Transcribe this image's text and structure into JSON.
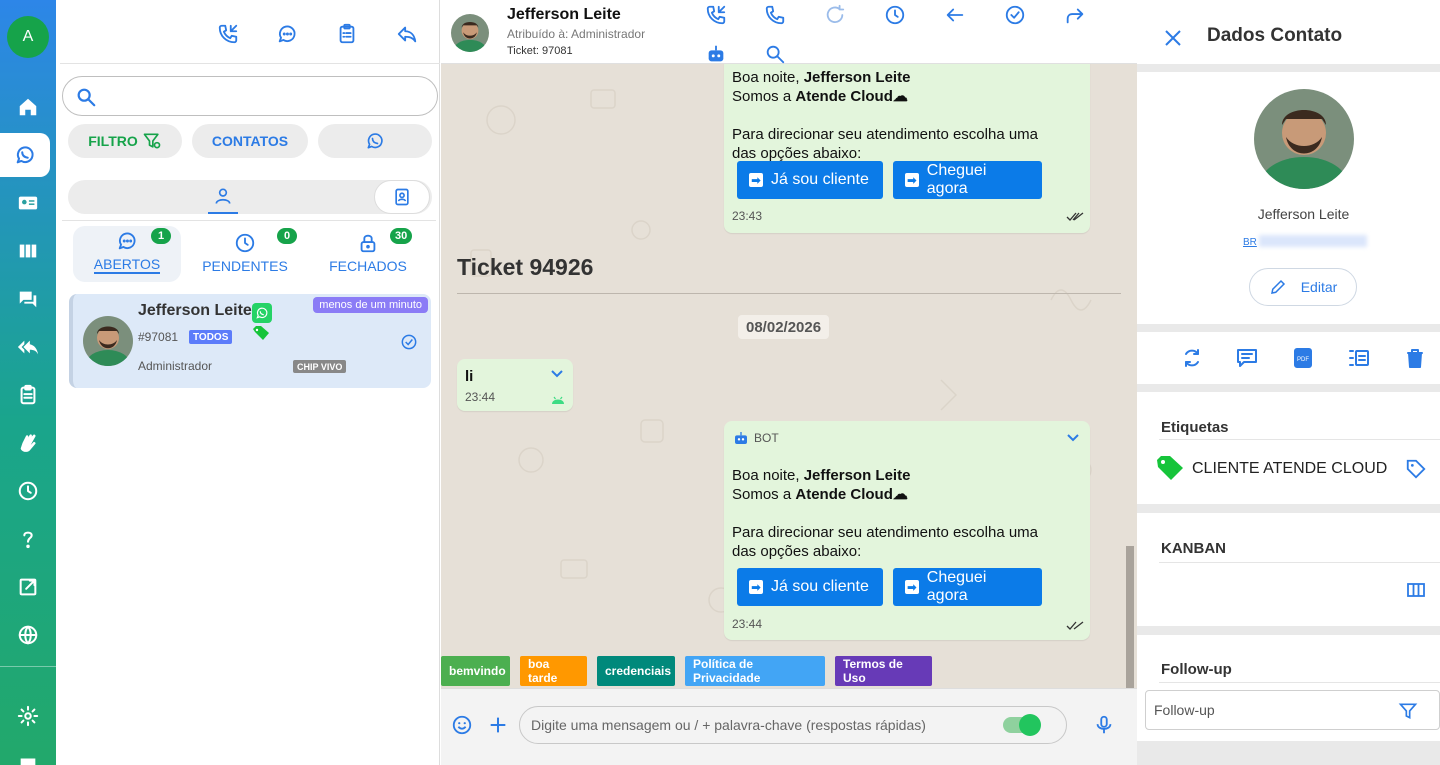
{
  "user_avatar_letter": "A",
  "list": {
    "filter_label": "FILTRO",
    "contacts_label": "CONTATOS",
    "tabs": [
      {
        "label": "ABERTOS",
        "count": "1"
      },
      {
        "label": "PENDENTES",
        "count": "0"
      },
      {
        "label": "FECHADOS",
        "count": "30"
      }
    ],
    "ticket": {
      "name": "Jefferson Leite",
      "time": "menos de um minuto",
      "number": "#97081",
      "queue": "TODOS",
      "agent": "Administrador",
      "connection": "CHIP VIVO"
    }
  },
  "chat": {
    "contact_name": "Jefferson Leite",
    "assigned": "Atribuído à: Administrador",
    "ticket_label": "Ticket: 97081",
    "msg1": {
      "greeting_prefix": "Boa noite, ",
      "greeting_name": "Jefferson Leite",
      "company_prefix": "Somos a ",
      "company_name": "Atende Cloud",
      "cloud": "☁",
      "prompt_line1": "Para direcionar seu atendimento escolha uma",
      "prompt_line2": "das opções abaixo:",
      "btn1": "Já sou cliente",
      "btn2": "Cheguei agora",
      "time": "23:43"
    },
    "ticket_title": "Ticket 94926",
    "date": "08/02/2026",
    "msg_in": {
      "text": "li",
      "time": "23:44"
    },
    "msg2": {
      "sender": "BOT",
      "greeting_prefix": "Boa noite, ",
      "greeting_name": "Jefferson Leite",
      "company_prefix": "Somos a ",
      "company_name": "Atende Cloud",
      "cloud": "☁",
      "prompt_line1": "Para direcionar seu atendimento escolha uma",
      "prompt_line2": "das opções abaixo:",
      "btn1": "Já sou cliente",
      "btn2": "Cheguei agora",
      "time": "23:44"
    },
    "quick_replies": [
      {
        "label": "bemvindo",
        "color": "#4caf50"
      },
      {
        "label": "boa tarde",
        "color": "#ff9800"
      },
      {
        "label": "credenciais",
        "color": "#00897b"
      },
      {
        "label": "Política de Privacidade",
        "color": "#42a5f5"
      },
      {
        "label": "Termos de Uso",
        "color": "#673ab7"
      }
    ],
    "input_placeholder": "Digite uma mensagem ou / + palavra-chave (respostas rápidas)"
  },
  "contact": {
    "title": "Dados Contato",
    "name": "Jefferson Leite",
    "phone_prefix": "BR",
    "edit_label": "Editar",
    "tags_heading": "Etiquetas",
    "tag": "CLIENTE ATENDE CLOUD",
    "kanban_heading": "KANBAN",
    "followup_heading": "Follow-up",
    "followup_placeholder": "Follow-up"
  },
  "colors": {
    "accent": "#2c7be5",
    "whatsapp": "#25d366",
    "bot_button": "#0b7be8"
  }
}
